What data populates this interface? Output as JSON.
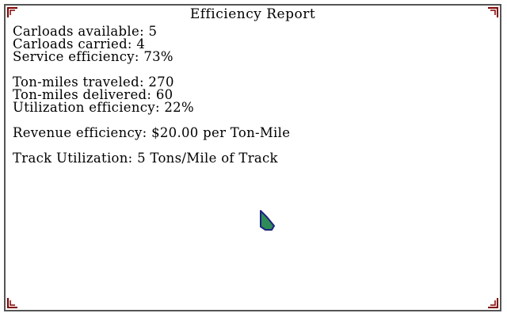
{
  "window": {
    "title": "Efficiency Report"
  },
  "report": {
    "carloads_available": "Carloads available: 5",
    "carloads_carried": "Carloads carried: 4",
    "service_efficiency": "Service efficiency: 73%",
    "ton_miles_traveled": "Ton-miles traveled: 270",
    "ton_miles_delivered": "Ton-miles delivered: 60",
    "utilization_efficiency": "Utilization efficiency: 22%",
    "revenue_efficiency": "Revenue efficiency: $20.00 per Ton-Mile",
    "track_utilization": "Track Utilization: 5 Tons/Mile of Track"
  },
  "colors": {
    "border": "#555555",
    "corner": "#800000",
    "cursor_fill": "#2e8b57",
    "cursor_outline": "#1a237e"
  },
  "icons": {
    "cursor": "pointer-arrow-icon",
    "corner": "corner-bracket-icon"
  }
}
